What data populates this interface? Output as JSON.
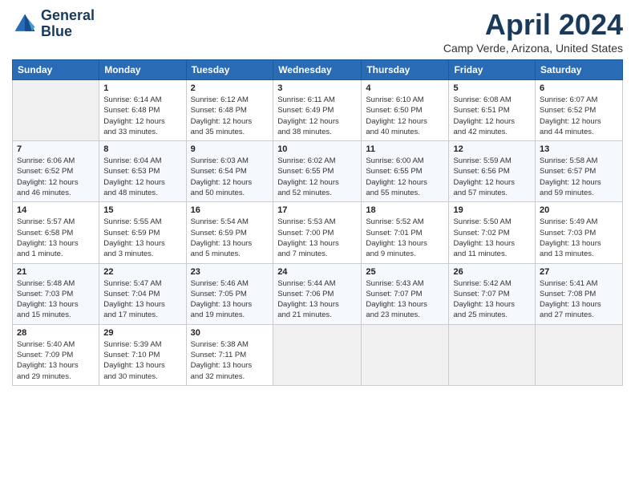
{
  "header": {
    "logo_line1": "General",
    "logo_line2": "Blue",
    "month_year": "April 2024",
    "location": "Camp Verde, Arizona, United States"
  },
  "days_of_week": [
    "Sunday",
    "Monday",
    "Tuesday",
    "Wednesday",
    "Thursday",
    "Friday",
    "Saturday"
  ],
  "weeks": [
    [
      {
        "day": "",
        "info": ""
      },
      {
        "day": "1",
        "info": "Sunrise: 6:14 AM\nSunset: 6:48 PM\nDaylight: 12 hours\nand 33 minutes."
      },
      {
        "day": "2",
        "info": "Sunrise: 6:12 AM\nSunset: 6:48 PM\nDaylight: 12 hours\nand 35 minutes."
      },
      {
        "day": "3",
        "info": "Sunrise: 6:11 AM\nSunset: 6:49 PM\nDaylight: 12 hours\nand 38 minutes."
      },
      {
        "day": "4",
        "info": "Sunrise: 6:10 AM\nSunset: 6:50 PM\nDaylight: 12 hours\nand 40 minutes."
      },
      {
        "day": "5",
        "info": "Sunrise: 6:08 AM\nSunset: 6:51 PM\nDaylight: 12 hours\nand 42 minutes."
      },
      {
        "day": "6",
        "info": "Sunrise: 6:07 AM\nSunset: 6:52 PM\nDaylight: 12 hours\nand 44 minutes."
      }
    ],
    [
      {
        "day": "7",
        "info": "Sunrise: 6:06 AM\nSunset: 6:52 PM\nDaylight: 12 hours\nand 46 minutes."
      },
      {
        "day": "8",
        "info": "Sunrise: 6:04 AM\nSunset: 6:53 PM\nDaylight: 12 hours\nand 48 minutes."
      },
      {
        "day": "9",
        "info": "Sunrise: 6:03 AM\nSunset: 6:54 PM\nDaylight: 12 hours\nand 50 minutes."
      },
      {
        "day": "10",
        "info": "Sunrise: 6:02 AM\nSunset: 6:55 PM\nDaylight: 12 hours\nand 52 minutes."
      },
      {
        "day": "11",
        "info": "Sunrise: 6:00 AM\nSunset: 6:55 PM\nDaylight: 12 hours\nand 55 minutes."
      },
      {
        "day": "12",
        "info": "Sunrise: 5:59 AM\nSunset: 6:56 PM\nDaylight: 12 hours\nand 57 minutes."
      },
      {
        "day": "13",
        "info": "Sunrise: 5:58 AM\nSunset: 6:57 PM\nDaylight: 12 hours\nand 59 minutes."
      }
    ],
    [
      {
        "day": "14",
        "info": "Sunrise: 5:57 AM\nSunset: 6:58 PM\nDaylight: 13 hours\nand 1 minute."
      },
      {
        "day": "15",
        "info": "Sunrise: 5:55 AM\nSunset: 6:59 PM\nDaylight: 13 hours\nand 3 minutes."
      },
      {
        "day": "16",
        "info": "Sunrise: 5:54 AM\nSunset: 6:59 PM\nDaylight: 13 hours\nand 5 minutes."
      },
      {
        "day": "17",
        "info": "Sunrise: 5:53 AM\nSunset: 7:00 PM\nDaylight: 13 hours\nand 7 minutes."
      },
      {
        "day": "18",
        "info": "Sunrise: 5:52 AM\nSunset: 7:01 PM\nDaylight: 13 hours\nand 9 minutes."
      },
      {
        "day": "19",
        "info": "Sunrise: 5:50 AM\nSunset: 7:02 PM\nDaylight: 13 hours\nand 11 minutes."
      },
      {
        "day": "20",
        "info": "Sunrise: 5:49 AM\nSunset: 7:03 PM\nDaylight: 13 hours\nand 13 minutes."
      }
    ],
    [
      {
        "day": "21",
        "info": "Sunrise: 5:48 AM\nSunset: 7:03 PM\nDaylight: 13 hours\nand 15 minutes."
      },
      {
        "day": "22",
        "info": "Sunrise: 5:47 AM\nSunset: 7:04 PM\nDaylight: 13 hours\nand 17 minutes."
      },
      {
        "day": "23",
        "info": "Sunrise: 5:46 AM\nSunset: 7:05 PM\nDaylight: 13 hours\nand 19 minutes."
      },
      {
        "day": "24",
        "info": "Sunrise: 5:44 AM\nSunset: 7:06 PM\nDaylight: 13 hours\nand 21 minutes."
      },
      {
        "day": "25",
        "info": "Sunrise: 5:43 AM\nSunset: 7:07 PM\nDaylight: 13 hours\nand 23 minutes."
      },
      {
        "day": "26",
        "info": "Sunrise: 5:42 AM\nSunset: 7:07 PM\nDaylight: 13 hours\nand 25 minutes."
      },
      {
        "day": "27",
        "info": "Sunrise: 5:41 AM\nSunset: 7:08 PM\nDaylight: 13 hours\nand 27 minutes."
      }
    ],
    [
      {
        "day": "28",
        "info": "Sunrise: 5:40 AM\nSunset: 7:09 PM\nDaylight: 13 hours\nand 29 minutes."
      },
      {
        "day": "29",
        "info": "Sunrise: 5:39 AM\nSunset: 7:10 PM\nDaylight: 13 hours\nand 30 minutes."
      },
      {
        "day": "30",
        "info": "Sunrise: 5:38 AM\nSunset: 7:11 PM\nDaylight: 13 hours\nand 32 minutes."
      },
      {
        "day": "",
        "info": ""
      },
      {
        "day": "",
        "info": ""
      },
      {
        "day": "",
        "info": ""
      },
      {
        "day": "",
        "info": ""
      }
    ]
  ]
}
